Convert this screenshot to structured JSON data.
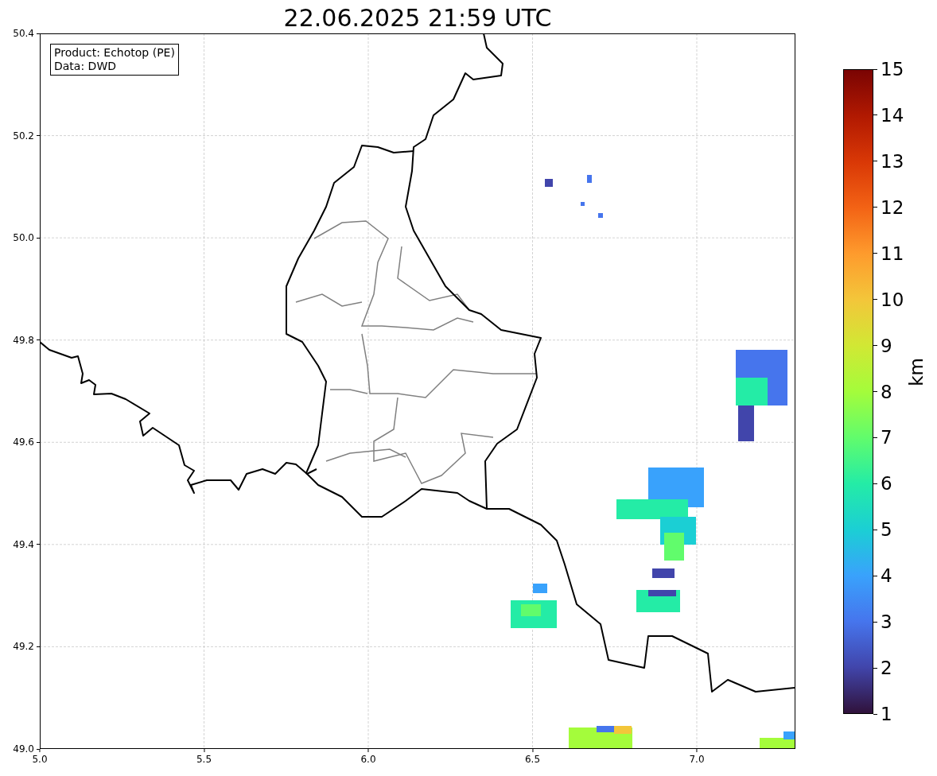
{
  "title": "22.06.2025 21:59 UTC",
  "info_box": {
    "lines": [
      "Product: Echotop (PE)",
      "Data: DWD"
    ]
  },
  "x_axis": {
    "ticks": [
      "5.0",
      "5.5",
      "6.0",
      "6.5",
      "7.0"
    ]
  },
  "y_axis": {
    "ticks": [
      "50.4",
      "50.2",
      "50.0",
      "49.8",
      "49.6",
      "49.4",
      "49.2",
      "49.0"
    ]
  },
  "colorbar": {
    "label": "km",
    "ticks": [
      "15",
      "14",
      "13",
      "12",
      "11",
      "10",
      "9",
      "8",
      "7",
      "6",
      "5",
      "4",
      "3",
      "2",
      "1"
    ]
  }
}
